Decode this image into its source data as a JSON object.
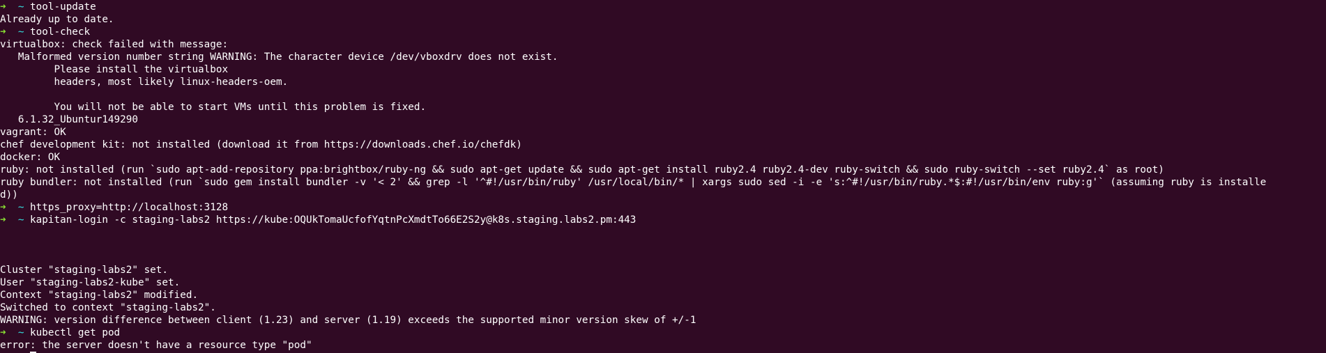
{
  "terminal": {
    "background": "#300a24",
    "foreground": "#ffffff",
    "prompt": {
      "arrow": "➜",
      "tilde": "~",
      "ok_color": "#8ae234",
      "error_color": "#ef2929",
      "dir_color": "#34e2e2"
    },
    "lines": [
      {
        "type": "prompt",
        "status": "ok",
        "command": "tool-update"
      },
      {
        "type": "output",
        "text": "Already up to date."
      },
      {
        "type": "prompt",
        "status": "ok",
        "command": "tool-check"
      },
      {
        "type": "output",
        "text": "virtualbox: check failed with message:"
      },
      {
        "type": "output",
        "text": "   Malformed version number string WARNING: The character device /dev/vboxdrv does not exist."
      },
      {
        "type": "output",
        "text": "         Please install the virtualbox"
      },
      {
        "type": "output",
        "text": "         headers, most likely linux-headers-oem."
      },
      {
        "type": "output",
        "text": ""
      },
      {
        "type": "output",
        "text": "         You will not be able to start VMs until this problem is fixed."
      },
      {
        "type": "output",
        "text": "   6.1.32_Ubuntur149290"
      },
      {
        "type": "output",
        "text": "vagrant: OK"
      },
      {
        "type": "output",
        "text": "chef development kit: not installed (download it from https://downloads.chef.io/chefdk)"
      },
      {
        "type": "output",
        "text": "docker: OK"
      },
      {
        "type": "output",
        "text": "ruby: not installed (run `sudo apt-add-repository ppa:brightbox/ruby-ng && sudo apt-get update && sudo apt-get install ruby2.4 ruby2.4-dev ruby-switch && sudo ruby-switch --set ruby2.4` as root)"
      },
      {
        "type": "output",
        "text": "ruby bundler: not installed (run `sudo gem install bundler -v '< 2' && grep -l '^#!/usr/bin/ruby' /usr/local/bin/* | xargs sudo sed -i -e 's:^#!/usr/bin/ruby.*$:#!/usr/bin/env ruby:g'` (assuming ruby is installe"
      },
      {
        "type": "output",
        "text": "d))"
      },
      {
        "type": "prompt",
        "status": "ok",
        "command": "https_proxy=http://localhost:3128"
      },
      {
        "type": "prompt",
        "status": "ok",
        "command": "kapitan-login -c staging-labs2 https://kube:OQUkTomaUcfofYqtnPcXmdtTo66E2S2y@k8s.staging.labs2.pm:443"
      },
      {
        "type": "output",
        "text": ""
      },
      {
        "type": "output",
        "text": ""
      },
      {
        "type": "output",
        "text": ""
      },
      {
        "type": "output",
        "text": "Cluster \"staging-labs2\" set."
      },
      {
        "type": "output",
        "text": "User \"staging-labs2-kube\" set."
      },
      {
        "type": "output",
        "text": "Context \"staging-labs2\" modified."
      },
      {
        "type": "output",
        "text": "Switched to context \"staging-labs2\"."
      },
      {
        "type": "output",
        "text": "WARNING: version difference between client (1.23) and server (1.19) exceeds the supported minor version skew of +/-1"
      },
      {
        "type": "prompt",
        "status": "ok",
        "command": "kubectl get pod"
      },
      {
        "type": "output",
        "text": "error: the server doesn't have a resource type \"pod\""
      },
      {
        "type": "prompt",
        "status": "error",
        "command": "",
        "cursor": true
      }
    ]
  }
}
